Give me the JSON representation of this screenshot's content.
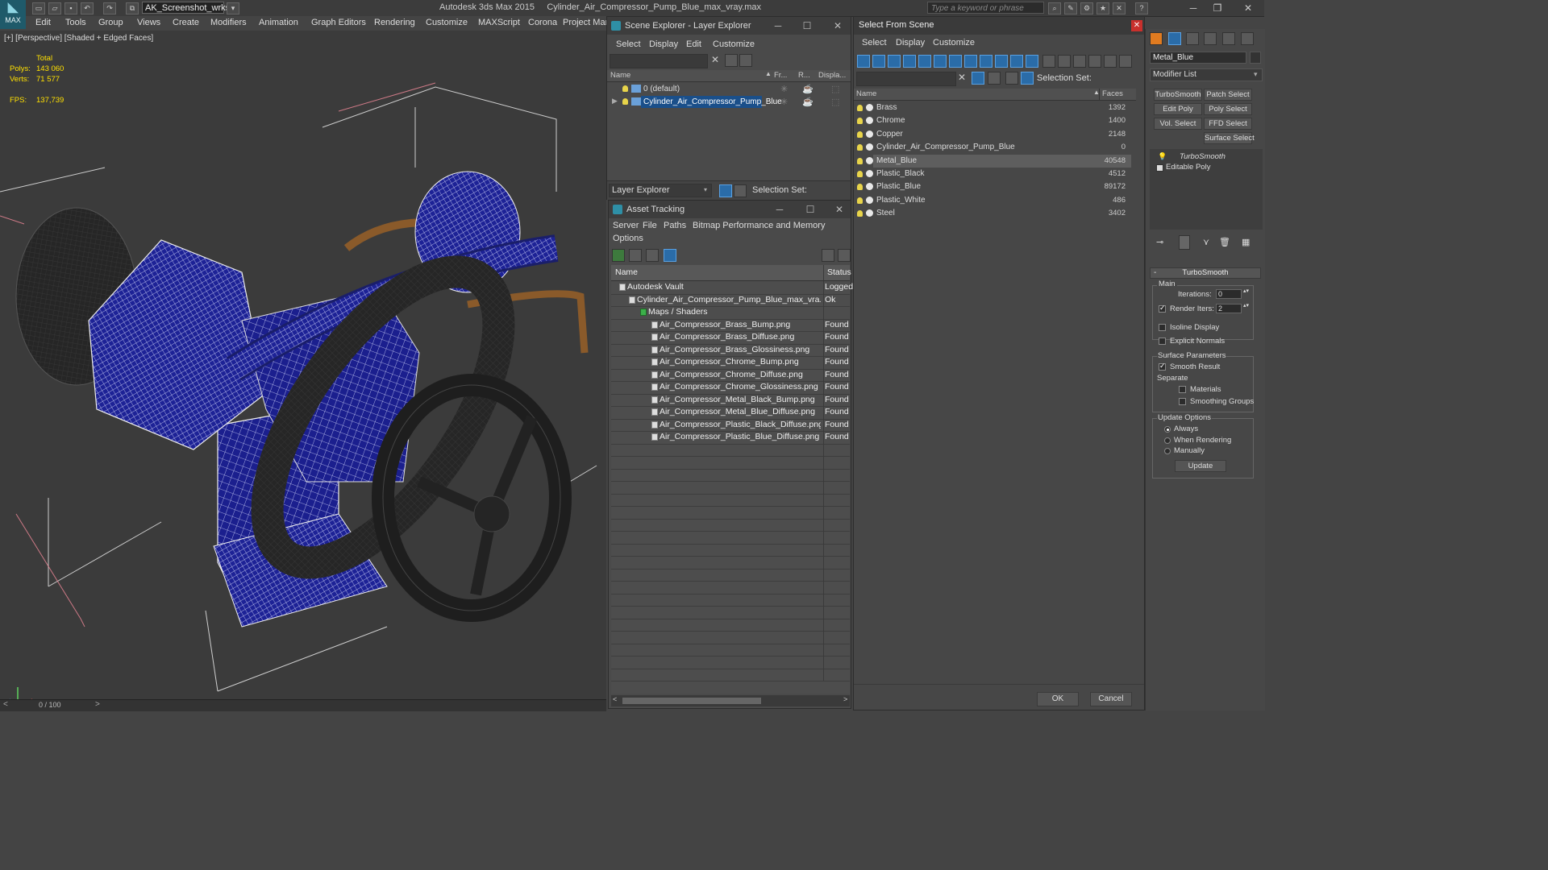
{
  "window": {
    "app_title": "Autodesk 3ds Max  2015",
    "file_name": "Cylinder_Air_Compressor_Pump_Blue_max_vray.max",
    "logo_label": "MAX",
    "workspace": "AK_Screenshot_wrksp",
    "search_placeholder": "Type a keyword or phrase"
  },
  "menu": [
    "Edit",
    "Tools",
    "Group",
    "Views",
    "Create",
    "Modifiers",
    "Animation",
    "Graph Editors",
    "Rendering",
    "Customize",
    "MAXScript",
    "Corona",
    "Project Man"
  ],
  "viewport": {
    "label": "[+] [Perspective] [Shaded + Edged Faces]",
    "stats_header": "Total",
    "polys_label": "Polys:",
    "polys_value": "143 060",
    "verts_label": "Verts:",
    "verts_value": "71 577",
    "fps_label": "FPS:",
    "fps_value": "137,739"
  },
  "timeline": {
    "frame": "0 / 100"
  },
  "scene_explorer": {
    "title": "Scene Explorer - Layer Explorer",
    "menus": [
      "Select",
      "Display",
      "Edit",
      "Customize"
    ],
    "columns": [
      "Name",
      "Fr...",
      "R...",
      "Displa..."
    ],
    "rows": [
      {
        "name": "0 (default)"
      },
      {
        "name": "Cylinder_Air_Compressor_Pump_Blue"
      }
    ],
    "footer_dropdown": "Layer Explorer",
    "selection_set_label": "Selection Set:"
  },
  "asset_tracking": {
    "title": "Asset Tracking",
    "menus": [
      "Server",
      "File",
      "Paths",
      "Bitmap Performance and Memory"
    ],
    "menu_row2": [
      "Options"
    ],
    "columns": [
      "Name",
      "Status"
    ],
    "rows": [
      {
        "name": "Autodesk Vault",
        "status": "Logged"
      },
      {
        "name": "Cylinder_Air_Compressor_Pump_Blue_max_vra...",
        "status": "Ok"
      },
      {
        "name": "Maps / Shaders",
        "status": ""
      },
      {
        "name": "Air_Compressor_Brass_Bump.png",
        "status": "Found"
      },
      {
        "name": "Air_Compressor_Brass_Diffuse.png",
        "status": "Found"
      },
      {
        "name": "Air_Compressor_Brass_Glossiness.png",
        "status": "Found"
      },
      {
        "name": "Air_Compressor_Chrome_Bump.png",
        "status": "Found"
      },
      {
        "name": "Air_Compressor_Chrome_Diffuse.png",
        "status": "Found"
      },
      {
        "name": "Air_Compressor_Chrome_Glossiness.png",
        "status": "Found"
      },
      {
        "name": "Air_Compressor_Metal_Black_Bump.png",
        "status": "Found"
      },
      {
        "name": "Air_Compressor_Metal_Blue_Diffuse.png",
        "status": "Found"
      },
      {
        "name": "Air_Compressor_Plastic_Black_Diffuse.png",
        "status": "Found"
      },
      {
        "name": "Air_Compressor_Plastic_Blue_Diffuse.png",
        "status": "Found"
      }
    ]
  },
  "select_from_scene": {
    "title": "Select From Scene",
    "menus": [
      "Select",
      "Display",
      "Customize"
    ],
    "selection_set_label": "Selection Set:",
    "columns": [
      "Name",
      "Faces"
    ],
    "rows": [
      {
        "name": "Brass",
        "faces": "1392"
      },
      {
        "name": "Chrome",
        "faces": "1400"
      },
      {
        "name": "Copper",
        "faces": "2148"
      },
      {
        "name": "Cylinder_Air_Compressor_Pump_Blue",
        "faces": "0"
      },
      {
        "name": "Metal_Blue",
        "faces": "40548"
      },
      {
        "name": "Plastic_Black",
        "faces": "4512"
      },
      {
        "name": "Plastic_Blue",
        "faces": "89172"
      },
      {
        "name": "Plastic_White",
        "faces": "486"
      },
      {
        "name": "Steel",
        "faces": "3402"
      }
    ],
    "ok": "OK",
    "cancel": "Cancel"
  },
  "command_panel": {
    "object_name": "Metal_Blue",
    "modifier_list": "Modifier List",
    "buttons": [
      "TurboSmooth",
      "Patch Select",
      "Edit Poly",
      "Poly Select",
      "Vol. Select",
      "FFD Select",
      "Surface Select"
    ],
    "stack": [
      "TurboSmooth",
      "Editable Poly"
    ],
    "rollout_title": "TurboSmooth",
    "main_label": "Main",
    "iterations_label": "Iterations:",
    "iterations_value": "0",
    "render_iters_label": "Render Iters:",
    "render_iters_value": "2",
    "isoline_label": "Isoline Display",
    "explicit_label": "Explicit Normals",
    "surface_params_label": "Surface Parameters",
    "smooth_result_label": "Smooth Result",
    "separate_label": "Separate",
    "materials_label": "Materials",
    "smoothing_groups_label": "Smoothing Groups",
    "update_options_label": "Update Options",
    "always_label": "Always",
    "when_rendering_label": "When Rendering",
    "manually_label": "Manually",
    "update_button": "Update"
  },
  "colors": {
    "accent_blue": "#2a6ca8",
    "selection_highlight": "#1a4f8a",
    "stats_yellow": "#ffe000",
    "wire_blue": "#1b1f8e"
  }
}
